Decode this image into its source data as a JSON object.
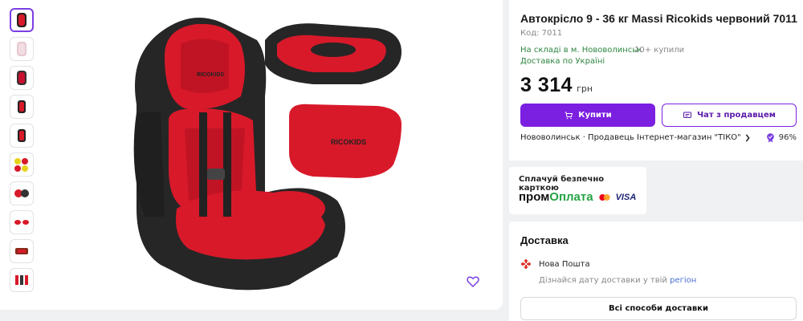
{
  "product": {
    "title": "Автокрісло 9 - 36 кг Massi Ricokids червоний 7011",
    "code_text": "Код: 7011",
    "stock_text": "На складі в м. Нововолинськ",
    "sold_text": "10+ купили",
    "delivery_text": "Доставка по Україні",
    "price": "3 314",
    "currency": "грн"
  },
  "actions": {
    "buy_label": "Купити",
    "chat_label": "Чат з продавцем"
  },
  "seller": {
    "line": "Нововолинськ · Продавець Інтернет-магазин \"ТІКО\"",
    "rating": "96%"
  },
  "payment": {
    "title": "Сплачуй безпечно карткою",
    "brand_part1": "пром",
    "brand_part2": "Оплата",
    "visa": "VISA"
  },
  "delivery": {
    "title": "Доставка",
    "carrier": "Нова Пошта",
    "hint_text": "Дізнайся дату доставки у твій",
    "hint_link": "регіон",
    "all_button": "Всі способи доставки"
  },
  "images": {
    "brand_mark": "RICOKIDS",
    "thumbnail_count": 10
  },
  "colors": {
    "accent": "#7b1fe0",
    "in_stock": "#2e8540",
    "seat_red": "#d8192a"
  }
}
